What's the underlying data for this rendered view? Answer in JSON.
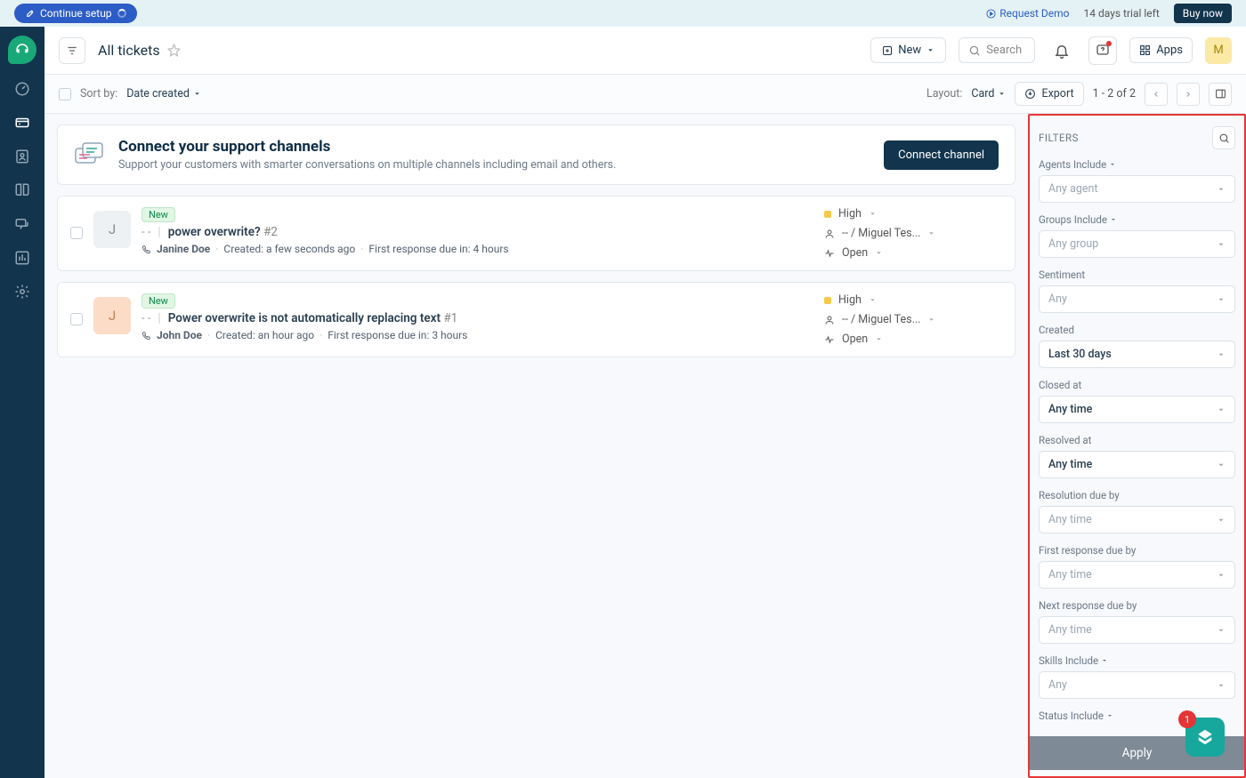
{
  "banner": {
    "setup": "Continue setup",
    "request_demo": "Request Demo",
    "trial": "14 days trial left",
    "buy": "Buy now"
  },
  "header": {
    "title": "All tickets",
    "new": "New",
    "search_placeholder": "Search",
    "apps": "Apps",
    "avatar_initial": "M"
  },
  "toolbar": {
    "sort_label": "Sort by:",
    "sort_value": "Date created",
    "layout_label": "Layout:",
    "layout_value": "Card",
    "export": "Export",
    "pager": "1 - 2 of 2"
  },
  "connect": {
    "title": "Connect your support channels",
    "subtitle": "Support your customers with smarter conversations on multiple channels including email and others.",
    "button": "Connect channel"
  },
  "tickets": [
    {
      "avatar_class": "grey",
      "avatar_initial": "J",
      "badge": "New",
      "ts": "- -",
      "subject": "power overwrite?",
      "id": "#2",
      "contact": "Janine Doe",
      "created": "Created: a few seconds ago",
      "response_due": "First response due in: 4 hours",
      "priority": "High",
      "agent": "-- / Miguel Tes...",
      "status": "Open"
    },
    {
      "avatar_class": "peach",
      "avatar_initial": "J",
      "badge": "New",
      "ts": "- -",
      "subject": "Power overwrite is not automatically replacing text",
      "id": "#1",
      "contact": "John Doe",
      "created": "Created: an hour ago",
      "response_due": "First response due in: 3 hours",
      "priority": "High",
      "agent": "-- / Miguel Tes...",
      "status": "Open"
    }
  ],
  "filters": {
    "title": "FILTERS",
    "groups": [
      {
        "label": "Agents Include",
        "collapsible": true,
        "placeholder": "Any agent",
        "value": ""
      },
      {
        "label": "Groups Include",
        "collapsible": true,
        "placeholder": "Any group",
        "value": ""
      },
      {
        "label": "Sentiment",
        "collapsible": false,
        "placeholder": "Any",
        "value": ""
      },
      {
        "label": "Created",
        "collapsible": false,
        "placeholder": "",
        "value": "Last 30 days"
      },
      {
        "label": "Closed at",
        "collapsible": false,
        "placeholder": "",
        "value": "Any time"
      },
      {
        "label": "Resolved at",
        "collapsible": false,
        "placeholder": "",
        "value": "Any time"
      },
      {
        "label": "Resolution due by",
        "collapsible": false,
        "placeholder": "Any time",
        "value": ""
      },
      {
        "label": "First response due by",
        "collapsible": false,
        "placeholder": "Any time",
        "value": ""
      },
      {
        "label": "Next response due by",
        "collapsible": false,
        "placeholder": "Any time",
        "value": ""
      },
      {
        "label": "Skills Include",
        "collapsible": true,
        "placeholder": "Any",
        "value": ""
      },
      {
        "label": "Status Include",
        "collapsible": true,
        "placeholder": "",
        "value": ""
      }
    ],
    "apply": "Apply"
  },
  "fab": {
    "badge": "1"
  }
}
